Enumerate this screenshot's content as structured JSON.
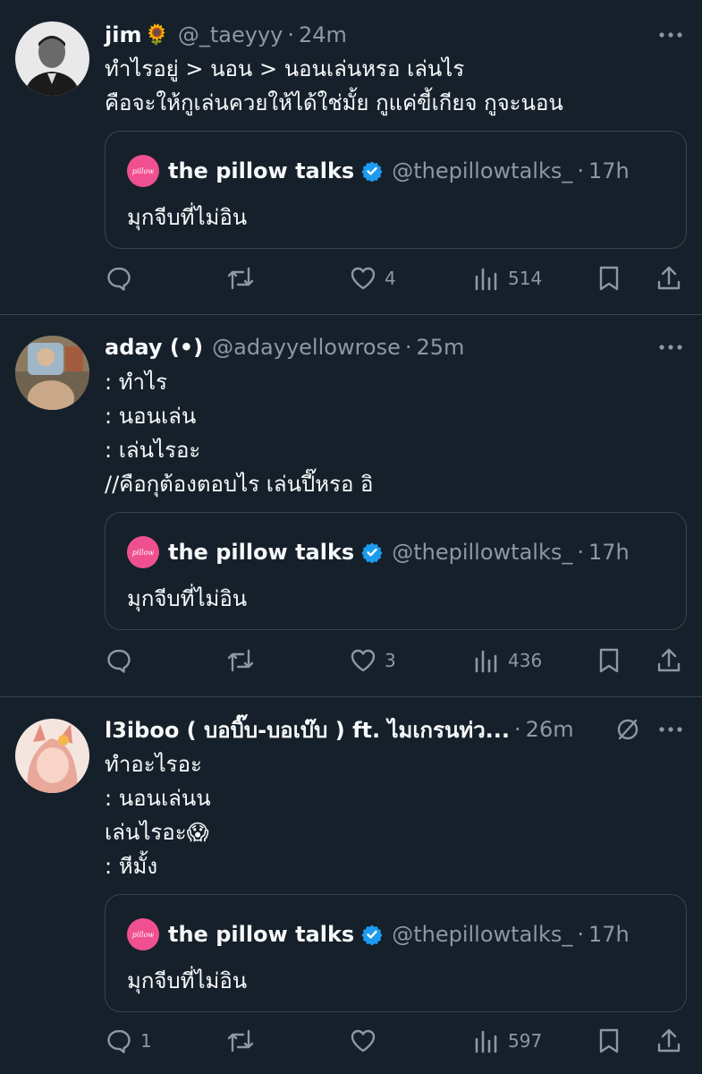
{
  "tweets": [
    {
      "name": "jim",
      "name_emoji": "🌻",
      "handle": "@_taeyyy",
      "time": "24m",
      "lines": [
        "ทำไรอยู่ > นอน > นอนเล่นหรอ เล่นไร",
        "คือจะให้กูเล่นควยให้ได้ใช่มั้ย กูแค่ขี้เกียจ กูจะนอน"
      ],
      "quote": {
        "name": "the pillow talks",
        "handle": "@thepillowtalks_",
        "time": "17h",
        "text": "มุกจีบที่ไม่อิน",
        "avatar_text": "pillow"
      },
      "reply_count": "",
      "retweet_count": "",
      "like_count": "4",
      "view_count": "514"
    },
    {
      "name": "aday (•)",
      "name_emoji": "",
      "handle": "@adayyellowrose",
      "time": "25m",
      "lines": [
        ": ทำไร",
        ": นอนเล่น",
        ": เล่นไรอะ",
        "//คือกุต้องตอบไร เล่นปี๊หรอ อิ"
      ],
      "quote": {
        "name": "the pillow talks",
        "handle": "@thepillowtalks_",
        "time": "17h",
        "text": "มุกจีบที่ไม่อิน",
        "avatar_text": "pillow"
      },
      "reply_count": "",
      "retweet_count": "",
      "like_count": "3",
      "view_count": "436"
    },
    {
      "name": "l3iboo ( บอบิ๊บ-บอเบ๊บ ) ft. ไมเกรนท่ว...",
      "name_emoji": "",
      "handle": "",
      "time": "26m",
      "lines": [
        "ทำอะไรอะ",
        ": นอนเล่นน",
        "เล่นไรอะ😱",
        ": หีมั้ง"
      ],
      "quote": {
        "name": "the pillow talks",
        "handle": "@thepillowtalks_",
        "time": "17h",
        "text": "มุกจีบที่ไม่อิน",
        "avatar_text": "pillow"
      },
      "reply_count": "1",
      "retweet_count": "",
      "like_count": "",
      "view_count": "597"
    }
  ],
  "icons": {
    "reply": "reply-icon",
    "retweet": "retweet-icon",
    "like": "heart-icon",
    "views": "views-icon",
    "bookmark": "bookmark-icon",
    "share": "share-icon",
    "more": "more-icon",
    "verified": "verified-badge-icon",
    "mute": "muted-icon"
  },
  "colors": {
    "background": "#15202b",
    "text": "#f7f9f9",
    "secondary": "#8b98a5",
    "border": "#38444d",
    "verified": "#1d9bf0",
    "quote_avatar": "#f0508f"
  }
}
